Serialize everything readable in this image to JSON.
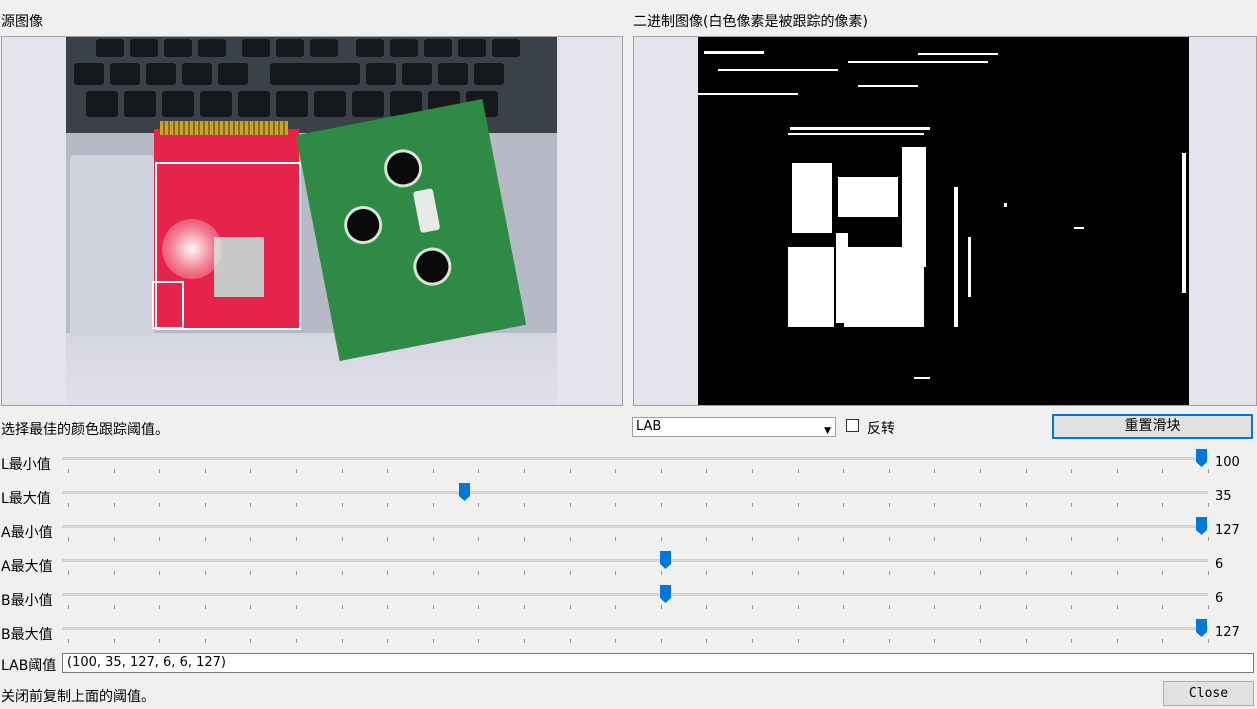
{
  "source_panel": {
    "title": "源图像"
  },
  "binary_panel": {
    "title": "二进制图像(白色像素是被跟踪的像素)"
  },
  "instruction": "选择最佳的颜色跟踪阈值。",
  "color_space": {
    "selected": "LAB"
  },
  "invert": {
    "label": "反转",
    "checked": false
  },
  "reset_button": {
    "label": "重置滑块"
  },
  "sliders": [
    {
      "label": "L最小值",
      "value": "100",
      "fraction": 1.0
    },
    {
      "label": "L最大值",
      "value": "35",
      "fraction": 0.35
    },
    {
      "label": "A最小值",
      "value": "127",
      "fraction": 1.0
    },
    {
      "label": "A最大值",
      "value": "6",
      "fraction": 0.527
    },
    {
      "label": "B最小值",
      "value": "6",
      "fraction": 0.527
    },
    {
      "label": "B最大值",
      "value": "127",
      "fraction": 1.0
    }
  ],
  "threshold": {
    "label": "LAB阈值",
    "value": "(100, 35, 127, 6, 6, 127)"
  },
  "footer": {
    "note": "关闭前复制上面的阈值。",
    "close_label": "Close"
  },
  "colors": {
    "accent": "#0078d7",
    "track": "#dcdcdc",
    "panel_bg": "#e4e4ec"
  },
  "icons": {
    "dropdown": "chevron-down-icon",
    "slider_thumb": "slider-thumb-icon"
  }
}
